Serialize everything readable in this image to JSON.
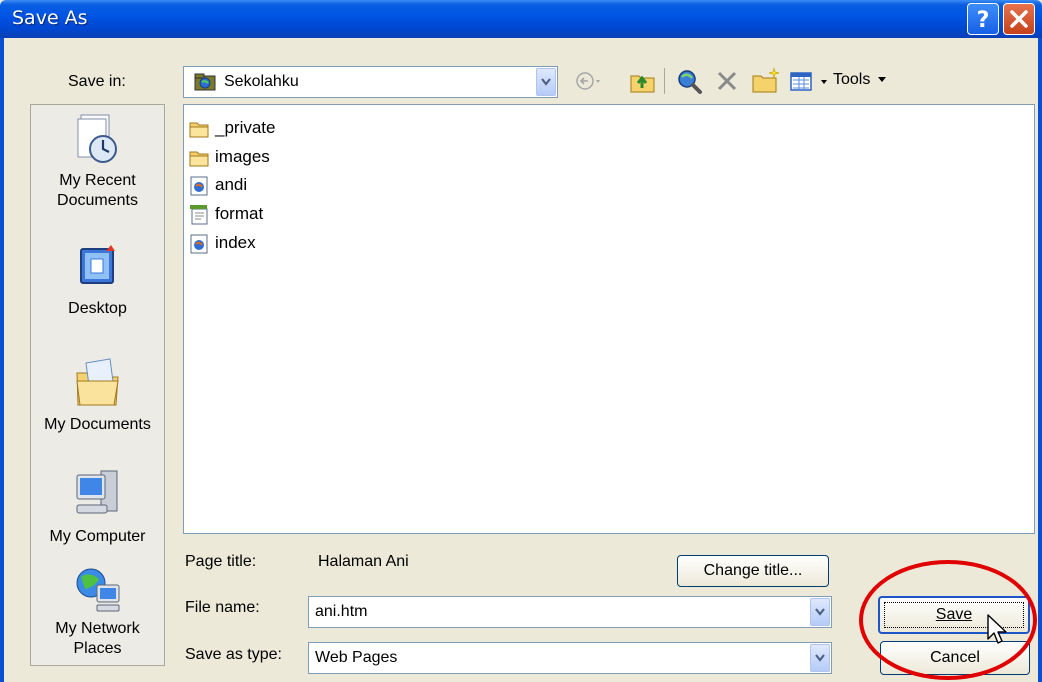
{
  "window": {
    "title": "Save As"
  },
  "titlebar": {
    "help_icon": "help-icon",
    "close_icon": "close-icon"
  },
  "save_in": {
    "label": "Save in:",
    "value": "Sekolahku"
  },
  "toolbar": {
    "tools_label": "Tools"
  },
  "places": [
    {
      "label": "My Recent Documents",
      "line1": "My Recent",
      "line2": "Documents",
      "icon": "recent-documents-icon"
    },
    {
      "label": "Desktop",
      "line1": "Desktop",
      "line2": "",
      "icon": "desktop-icon"
    },
    {
      "label": "My Documents",
      "line1": "My Documents",
      "line2": "",
      "icon": "my-documents-icon"
    },
    {
      "label": "My Computer",
      "line1": "My Computer",
      "line2": "",
      "icon": "my-computer-icon"
    },
    {
      "label": "My Network Places",
      "line1": "My Network",
      "line2": "Places",
      "icon": "network-places-icon"
    }
  ],
  "files": [
    {
      "name": "_private",
      "type": "folder"
    },
    {
      "name": "images",
      "type": "folder"
    },
    {
      "name": "andi",
      "type": "web-page"
    },
    {
      "name": "format",
      "type": "template"
    },
    {
      "name": "index",
      "type": "web-page"
    }
  ],
  "page_title": {
    "label": "Page title:",
    "value": "Halaman Ani"
  },
  "change_title_button": "Change title...",
  "file_name": {
    "label": "File name:",
    "value": "ani.htm"
  },
  "save_as_type": {
    "label": "Save as type:",
    "value": "Web Pages"
  },
  "buttons": {
    "save": "Save",
    "cancel": "Cancel"
  },
  "colors": {
    "titlebar": "#0055e5",
    "highlight_circle": "#e00000",
    "dialog_bg": "#ece9d8"
  }
}
